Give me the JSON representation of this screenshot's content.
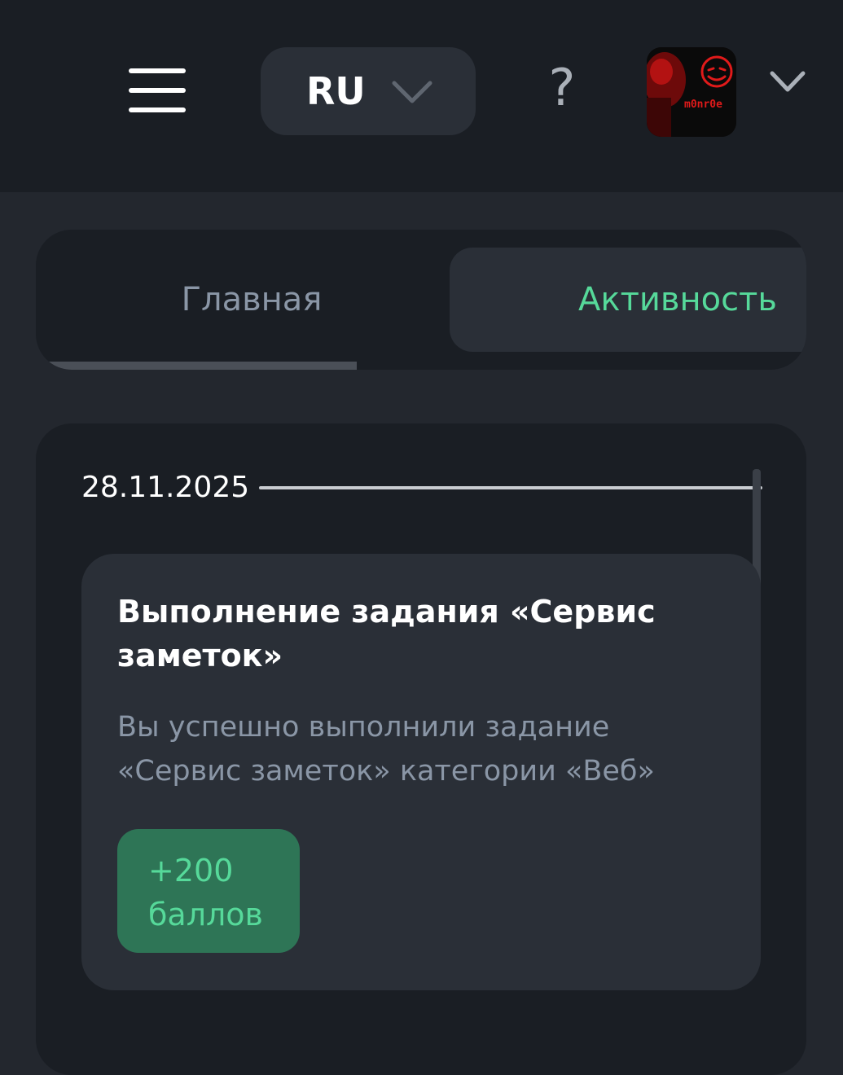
{
  "header": {
    "language": "RU",
    "help_symbol": "?",
    "avatar_text": "m0nr0e"
  },
  "tabs": [
    {
      "label": "Главная",
      "active": false
    },
    {
      "label": "Активность",
      "active": true
    }
  ],
  "activity": {
    "date": "28.11.2025",
    "card": {
      "title": "Выполнение задания «Сервис заметок»",
      "description": "Вы успешно выполнили задание «Сервис заметок» категории «Веб»",
      "points": "+200 баллов"
    }
  },
  "colors": {
    "accent": "#56d99a",
    "badge_bg": "#2e7556",
    "panel_bg": "#1a1e24",
    "card_bg": "#2a2f37"
  }
}
